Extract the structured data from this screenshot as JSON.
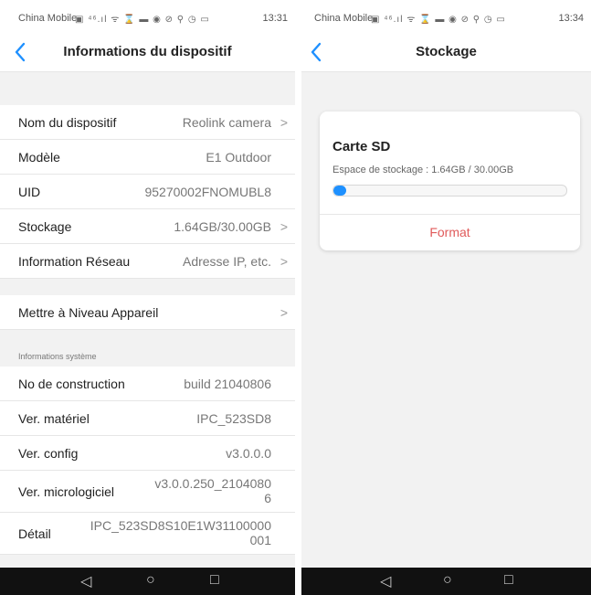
{
  "colors": {
    "accent": "#1e90ff",
    "format_red": "#e05a5a",
    "background": "#f2f2f2"
  },
  "left": {
    "status": {
      "carrier": "China Mobile",
      "icons": "▣ ⁴⁶.ıl ᯤ ⌛ ▬     ◉ ⊘ ⚲ ◷ ▭",
      "time": "13:31"
    },
    "nav": {
      "title": "Informations du dispositif"
    },
    "rows": [
      {
        "label": "Nom du dispositif",
        "value": "Reolink camera"
      },
      {
        "label": "Modèle",
        "value": "E1 Outdoor"
      },
      {
        "label": "UID",
        "value": "95270002FNOMUBL8"
      },
      {
        "label": "Stockage",
        "value": "1.64GB/30.00GB"
      },
      {
        "label": "Information Réseau",
        "value": "Adresse IP, etc."
      }
    ],
    "upgrade": {
      "label": "Mettre à Niveau Appareil"
    },
    "system_header": "Informations système",
    "system_rows": [
      {
        "label": "No de construction",
        "value": "build 21040806"
      },
      {
        "label": "Ver. matériel",
        "value": "IPC_523SD8"
      },
      {
        "label": "Ver. config",
        "value": "v3.0.0.0"
      },
      {
        "label": "Ver. micrologiciel",
        "value_line1": "v3.0.0.250_2104080",
        "value_line2": "6"
      },
      {
        "label": "Détail",
        "value_line1": "IPC_523SD8S10E1W31100000",
        "value_line2": "001"
      }
    ]
  },
  "right": {
    "status": {
      "carrier": "China Mobile",
      "icons": "▣ ⁴⁶.ıl ᯤ ⌛ ▬     ◉ ⊘ ⚲ ◷ ▭",
      "time": "13:34"
    },
    "nav": {
      "title": "Stockage"
    },
    "card": {
      "title": "Carte SD",
      "description": "Espace de stockage : 1.64GB / 30.00GB",
      "used_fraction": 0.055,
      "format_label": "Format"
    }
  },
  "nav_buttons": {
    "back": "◁",
    "home": "○",
    "recent": "□"
  },
  "icons": {
    "back": "chevron-left-icon",
    "row_arrow": "chevron-right-icon"
  }
}
